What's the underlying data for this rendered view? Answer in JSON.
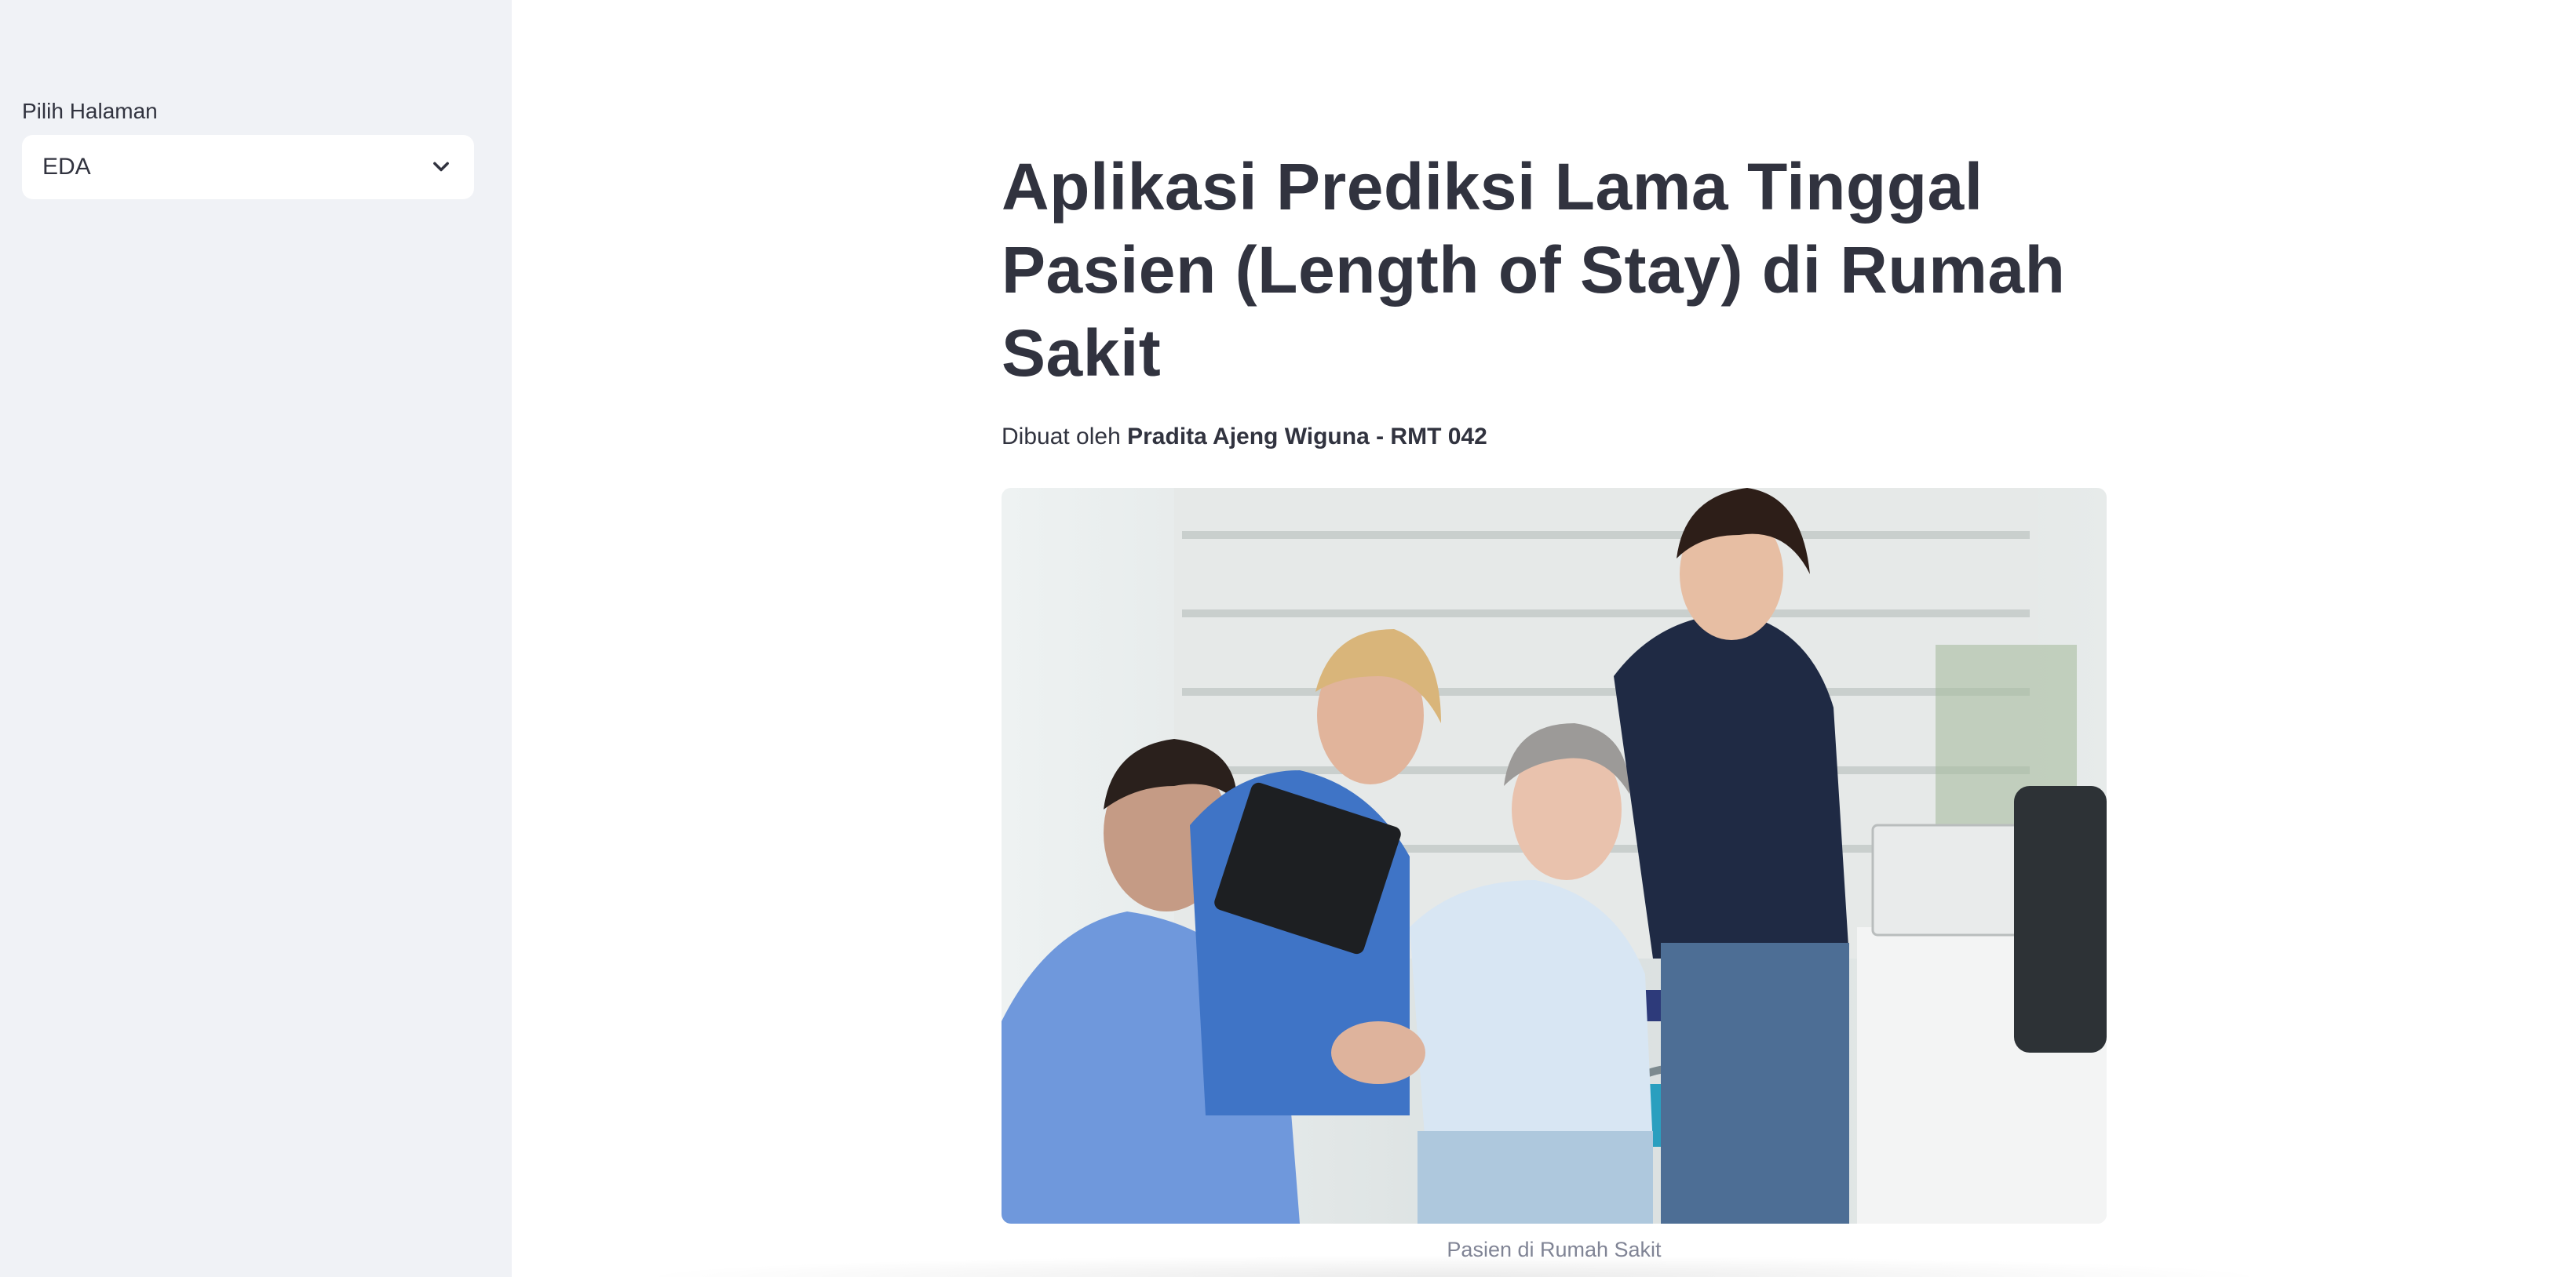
{
  "sidebar": {
    "select_label": "Pilih Halaman",
    "select_value": "EDA",
    "chevron_icon": "chevron-down-icon"
  },
  "main": {
    "title": "Aplikasi Prediksi Lama Tinggal Pasien (Length of Stay) di Rumah Sakit",
    "byline_prefix": "Dibuat oleh",
    "byline_author": "Pradita Ajeng Wiguna - RMT 042",
    "image_caption": "Pasien di Rumah Sakit"
  },
  "colors": {
    "sidebar_bg": "#f0f2f6",
    "text": "#31333f",
    "caption": "#808495"
  }
}
